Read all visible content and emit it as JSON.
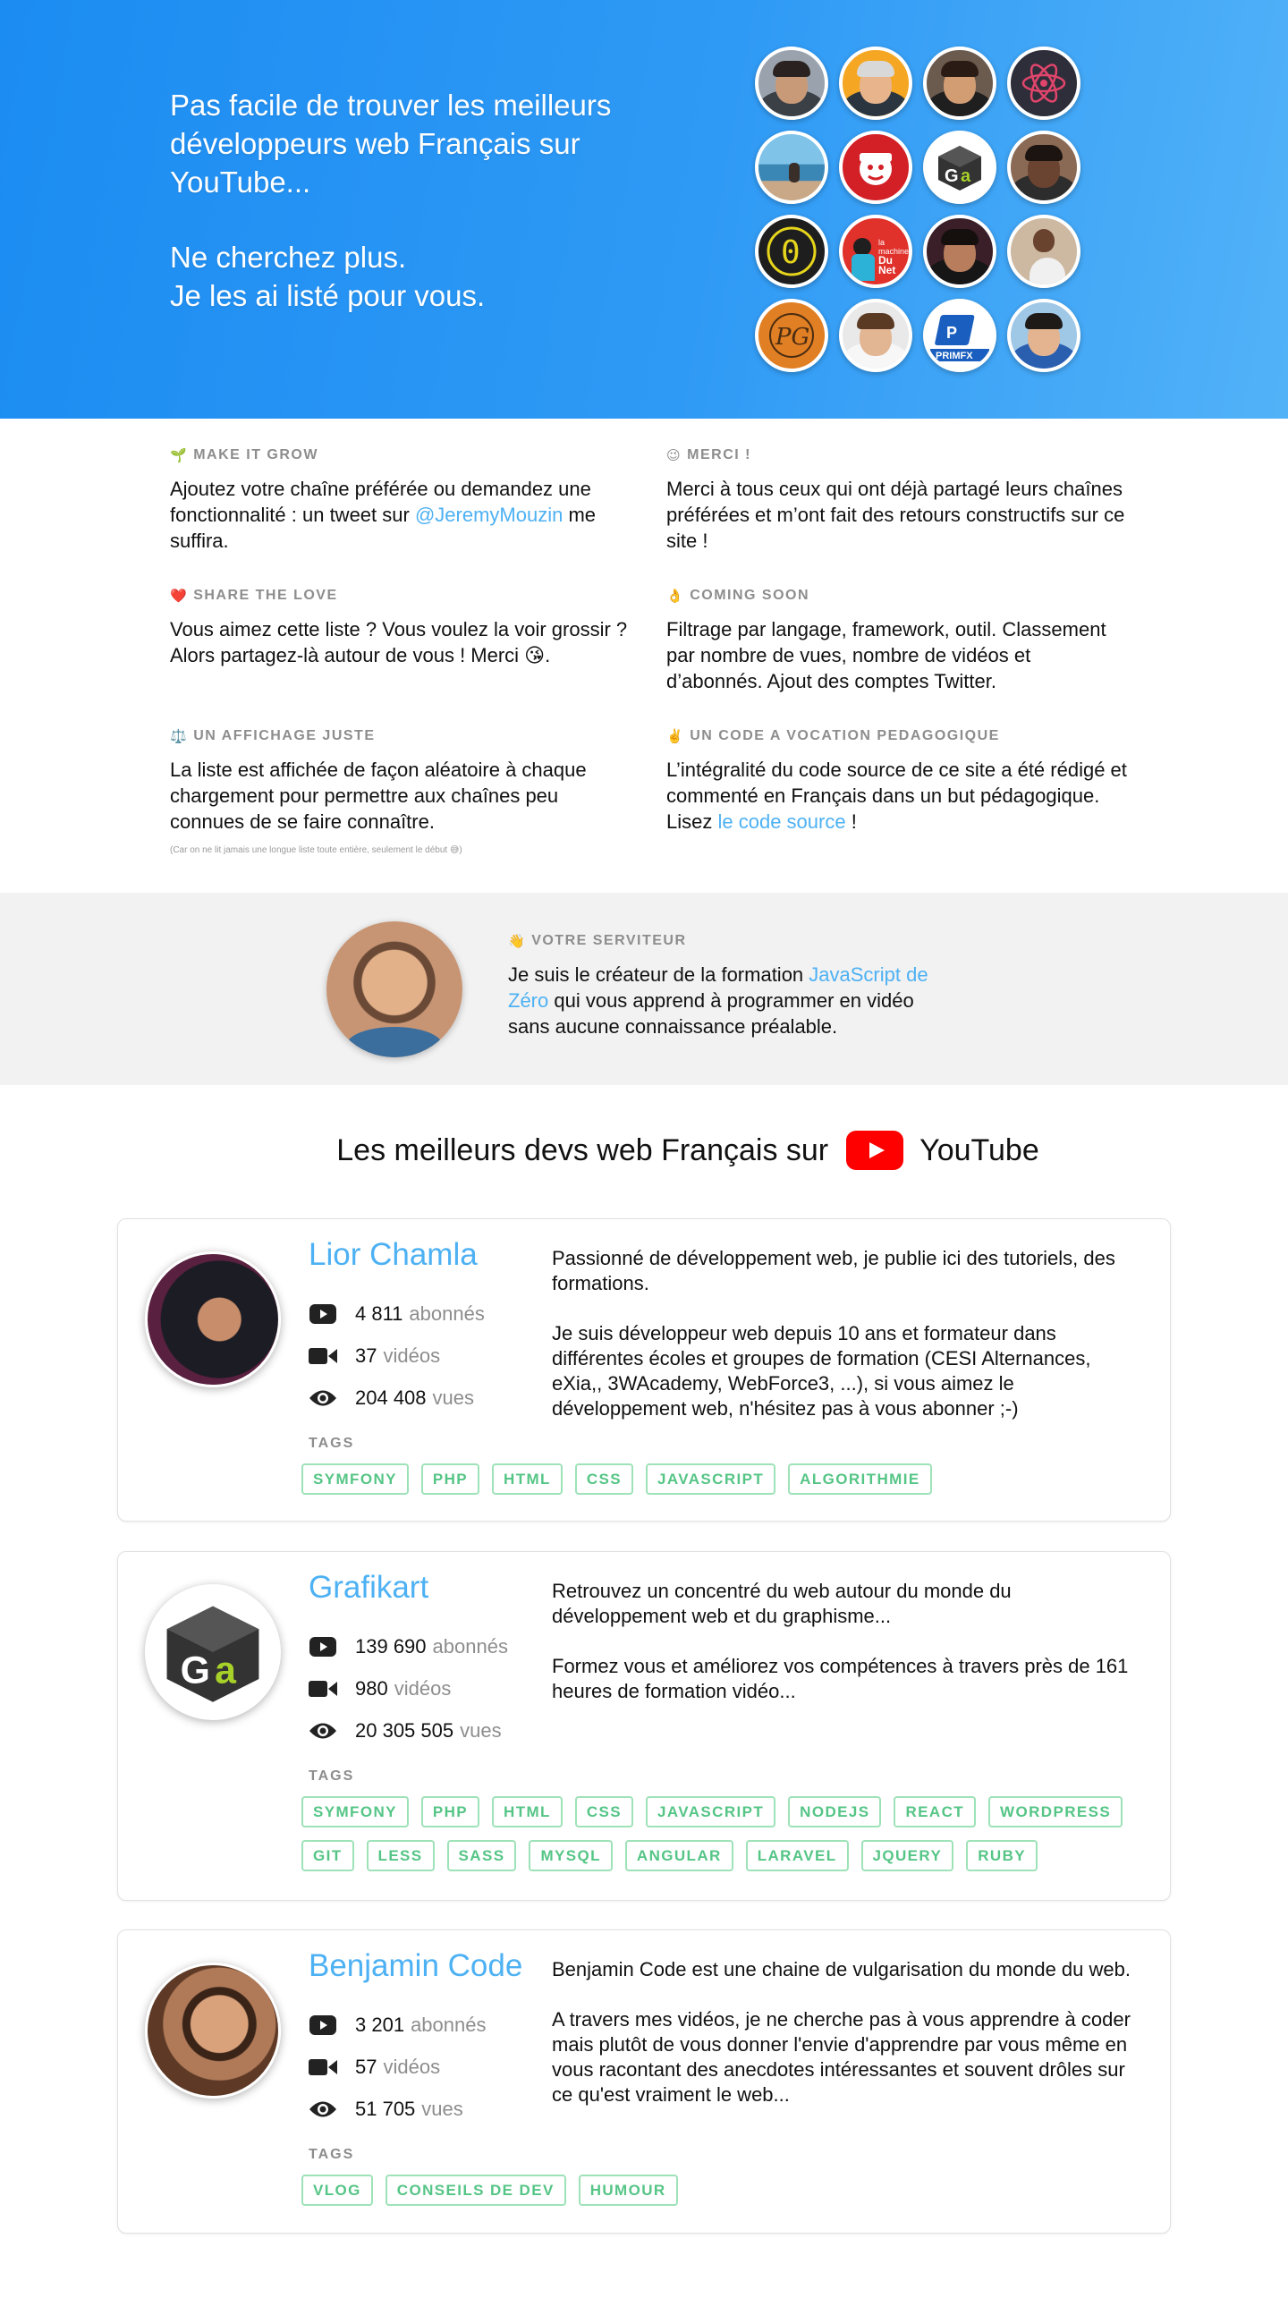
{
  "hero": {
    "line1": "Pas facile de trouver les meilleurs développeurs web Français sur YouTube...",
    "line2": "Ne cherchez plus.",
    "line3": "Je les ai listé pour vous."
  },
  "info": [
    {
      "icon": "seedling",
      "emoji": "🌱",
      "title": "MAKE IT GROW",
      "before": "Ajoutez votre chaîne préférée ou demandez une fonctionnalité : un tweet sur ",
      "link": "@JeremyMouzin",
      "after": " me suffira."
    },
    {
      "icon": "wink",
      "emoji": "😉",
      "title": "MERCI !",
      "before": "Merci à tous ceux qui ont déjà partagé leurs chaînes préférées et m’ont fait des retours constructifs sur ce site !",
      "link": "",
      "after": ""
    },
    {
      "icon": "heart",
      "emoji": "❤️",
      "title": "SHARE THE LOVE",
      "before": "Vous aimez cette liste ? Vous voulez la voir grossir ? Alors partagez-là autour de vous ! Merci 😘.",
      "link": "",
      "after": ""
    },
    {
      "icon": "ok-hand",
      "emoji": "👌",
      "title": "COMING SOON",
      "before": "Filtrage par langage, framework, outil. Classement par nombre de vues, nombre de vidéos et d’abonnés. Ajout des comptes Twitter.",
      "link": "",
      "after": ""
    },
    {
      "icon": "scales",
      "emoji": "⚖️",
      "title": "UN AFFICHAGE JUSTE",
      "before": "La liste est affichée de façon aléatoire à chaque chargement pour permettre aux chaînes peu connues de se faire connaître.",
      "link": "",
      "after": "",
      "note": "(Car on ne lit jamais une longue liste toute entière, seulement le début 😅)"
    },
    {
      "icon": "victory-hand",
      "emoji": "✌️",
      "title": "UN CODE A VOCATION PEDAGOGIQUE",
      "before": "L’intégralité du code source de ce site a été rédigé et commenté en Français dans un but pédagogique. Lisez ",
      "link": "le code source",
      "after": " !"
    }
  ],
  "servant": {
    "emoji": "👋",
    "title": "VOTRE SERVITEUR",
    "before": "Je suis le créateur de la formation ",
    "link": "JavaScript de Zéro",
    "after": " qui vous apprend à programmer en vidéo sans aucune connaissance préalable."
  },
  "heading": {
    "before": "Les meilleurs devs web Français sur",
    "after": "YouTube"
  },
  "tags_label": "TAGS",
  "stat_labels": {
    "subscribers": "abonnés",
    "videos": "vidéos",
    "views": "vues"
  },
  "channels": [
    {
      "name": "Lior Chamla",
      "subscribers": "4 811",
      "videos": "37",
      "views": "204 408",
      "desc": [
        "Passionné de développement web, je publie ici des tutoriels, des formations.",
        "Je suis développeur web depuis 10 ans et formateur dans différentes écoles et groupes de formation (CESI Alternances, eXia,, 3WAcademy, WebForce3, ...), si vous aimez le développement web, n'hésitez pas à vous abonner ;-)"
      ],
      "tags": [
        "SYMFONY",
        "PHP",
        "HTML",
        "CSS",
        "JAVASCRIPT",
        "ALGORITHMIE"
      ]
    },
    {
      "name": "Grafikart",
      "subscribers": "139 690",
      "videos": "980",
      "views": "20 305 505",
      "desc": [
        "Retrouvez un concentré du web autour du monde du développement web et du graphisme...",
        "Formez vous et améliorez vos compétences à travers près de 161 heures de formation vidéo..."
      ],
      "tags": [
        "SYMFONY",
        "PHP",
        "HTML",
        "CSS",
        "JAVASCRIPT",
        "NODEJS",
        "REACT",
        "WORDPRESS",
        "GIT",
        "LESS",
        "SASS",
        "MYSQL",
        "ANGULAR",
        "LARAVEL",
        "JQUERY",
        "RUBY"
      ]
    },
    {
      "name": "Benjamin Code",
      "subscribers": "3 201",
      "videos": "57",
      "views": "51 705",
      "desc": [
        "Benjamin Code est une chaine de vulgarisation du monde du web.",
        "A travers mes vidéos, je ne cherche pas à vous apprendre à coder mais plutôt de vous donner l'envie d'apprendre par vous même en vous racontant des anecdotes intéressantes et souvent drôles sur ce qu'est vraiment le web..."
      ],
      "tags": [
        "VLOG",
        "CONSEILS DE DEV",
        "HUMOUR"
      ]
    }
  ],
  "colors": {
    "link": "#4db1f3",
    "tag": "#55c586",
    "hero_start": "#1b8cf2",
    "hero_end": "#52b2f8",
    "youtube": "#ff0000"
  }
}
